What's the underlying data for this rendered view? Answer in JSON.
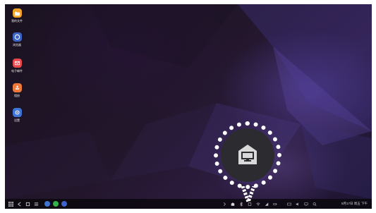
{
  "desktop": {
    "icons": [
      {
        "name": "my-files",
        "label": "我的文件",
        "color": "#f2a42a",
        "icon": "folder-icon"
      },
      {
        "name": "browser",
        "label": "浏览器",
        "color": "#3d64c8",
        "icon": "browser-icon"
      },
      {
        "name": "email",
        "label": "电子邮件",
        "color": "#e8484d",
        "icon": "mail-icon"
      },
      {
        "name": "gallery",
        "label": "相册",
        "color": "#f07838",
        "icon": "gallery-icon"
      },
      {
        "name": "settings",
        "label": "设置",
        "color": "#3d74d6",
        "icon": "gear-icon"
      }
    ]
  },
  "taskbar": {
    "apps": [
      {
        "name": "apps-grid",
        "icon": "grid-icon"
      },
      {
        "name": "back",
        "icon": "back-icon"
      },
      {
        "name": "home",
        "icon": "home-icon"
      },
      {
        "name": "recents",
        "icon": "recents-icon"
      },
      {
        "name": "pinned-app-1",
        "color": "#3d74d6"
      },
      {
        "name": "pinned-app-2",
        "color": "#2fb34a"
      },
      {
        "name": "pinned-app-3",
        "color": "#3d64c8"
      }
    ],
    "clock_text": "5月17日 周五 下午"
  },
  "callout": {
    "icon": "dex-station-icon"
  }
}
